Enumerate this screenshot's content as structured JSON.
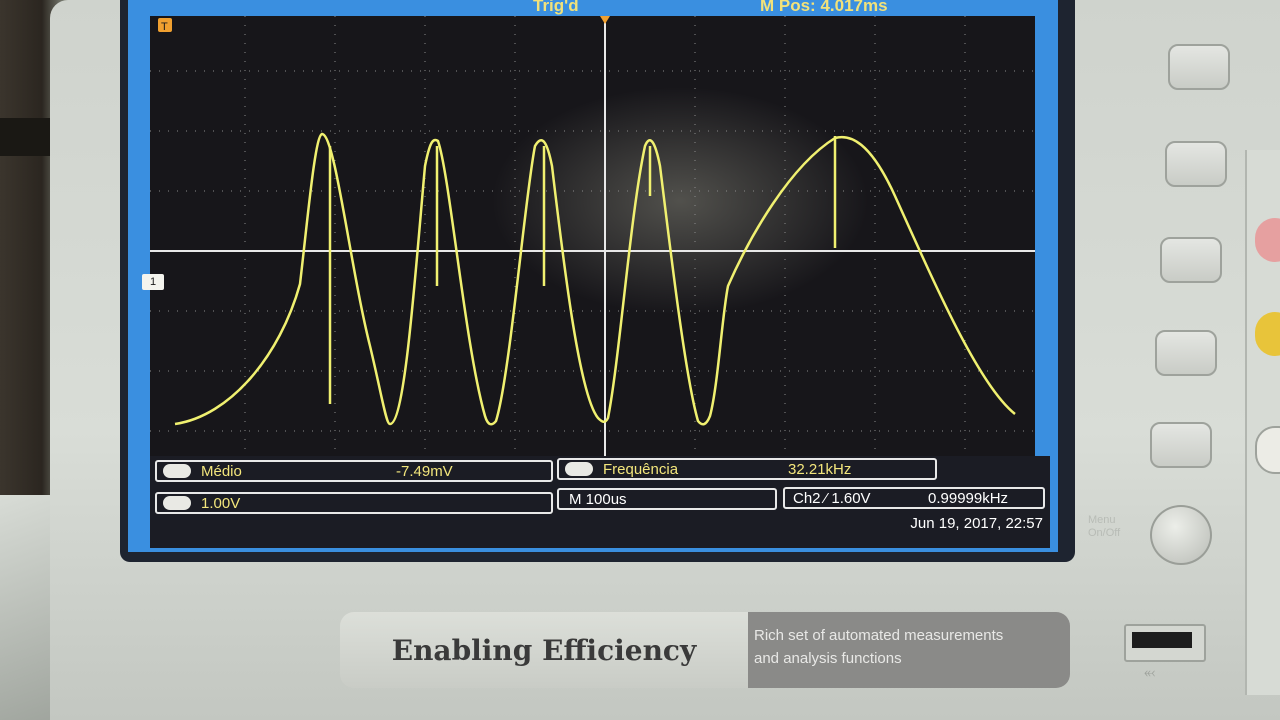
{
  "header": {
    "trig_status": "Trig'd",
    "mpos": "M Pos: 4.017ms"
  },
  "markers": {
    "trigger_level": "T",
    "channel": "1"
  },
  "measurements": {
    "m1_label": "Médio",
    "m1_value": "-7.49mV",
    "m2_label": "Frequência",
    "m2_value": "32.21kHz"
  },
  "status": {
    "ch1_scale": "1.00V",
    "timebase": "M 100us",
    "trigger_info": "Ch2 ⁄ 1.60V",
    "trigger_freq": "0.99999kHz",
    "datetime": "Jun 19, 2017, 22:57"
  },
  "controls": {
    "menu_label": "Menu On/Off"
  },
  "brand": {
    "slogan": "Enabling Efficiency",
    "tagline_1": "Rich set of automated measurements",
    "tagline_2": "and analysis functions"
  },
  "colors": {
    "trace": "#f0f070",
    "screen_blue": "#3a8fe0",
    "plot_bg": "#17161a",
    "text_yellow": "#f3e67c"
  },
  "icons": [
    "trigger-marker-icon",
    "channel-marker-icon",
    "usb-icon"
  ]
}
